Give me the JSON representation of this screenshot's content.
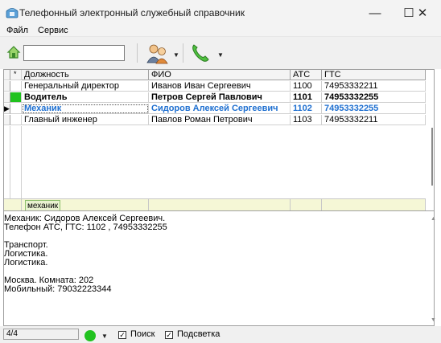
{
  "window": {
    "title": "Телефонный электронный служебный справочник",
    "min": "—",
    "max": "☐",
    "close": "✕"
  },
  "menu": [
    "Файл",
    "Сервис"
  ],
  "toolbar": {
    "search_value": ""
  },
  "table": {
    "columns": [
      "Должность",
      "ФИО",
      "АТС",
      "ГТС"
    ],
    "asterisk": "*",
    "rows": [
      {
        "role": "Генеральный директор",
        "name": "Иванов Иван Сергеевич",
        "ats": "1100",
        "gts": "74953332211",
        "style": "normal",
        "marked": false,
        "current": false
      },
      {
        "role": "Водитель",
        "name": "Петров Сергей Павлович",
        "ats": "1101",
        "gts": "74953332255",
        "style": "bold",
        "marked": true,
        "current": false
      },
      {
        "role": "Механик",
        "name": "Сидоров Алексей Сергеевич",
        "ats": "1102",
        "gts": "74953332255",
        "style": "blue",
        "marked": false,
        "current": true
      },
      {
        "role": "Главный инженер",
        "name": "Павлов Роман Петрович",
        "ats": "1103",
        "gts": "74953332211",
        "style": "normal",
        "marked": false,
        "current": false
      }
    ],
    "filter_value": "механик",
    "highlight_color": "#1e6fd0",
    "mark_color": "#21c21f"
  },
  "details": {
    "lines": [
      "Механик: Сидоров Алексей Сергеевич.",
      "Телефон АТС, ГТС: 1102 ,  74953332255",
      "",
      "Транспорт.",
      "Логистика.",
      "Логистика.",
      "",
      "Москва. Комната: 202",
      "Мобильный: 79032223344"
    ]
  },
  "status": {
    "count": "4/4",
    "search_label": "Поиск",
    "search_checked": true,
    "highlight_label": "Подсветка",
    "highlight_checked": true,
    "online_color": "#21c21f"
  }
}
